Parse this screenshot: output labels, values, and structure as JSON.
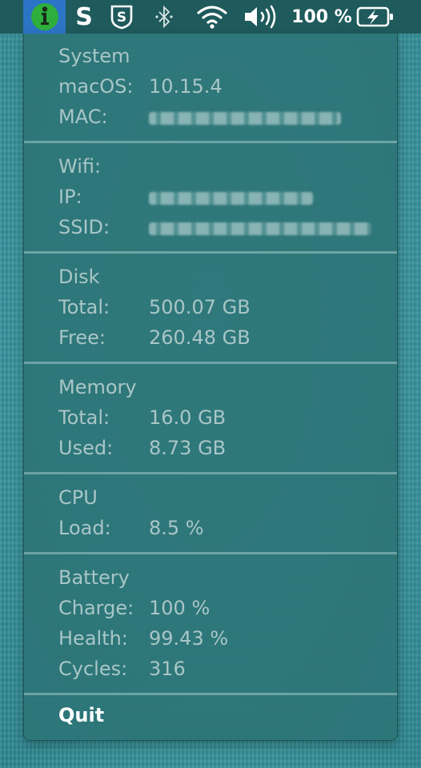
{
  "menubar": {
    "battery_percent": "100 %"
  },
  "sections": {
    "system": {
      "title": "System",
      "macos_label": "macOS:",
      "macos_value": "10.15.4",
      "mac_label": "MAC:"
    },
    "wifi": {
      "title": "Wifi:",
      "ip_label": "IP:",
      "ssid_label": "SSID:"
    },
    "disk": {
      "title": "Disk",
      "total_label": "Total:",
      "total_value": "500.07 GB",
      "free_label": "Free:",
      "free_value": "260.48 GB"
    },
    "memory": {
      "title": "Memory",
      "total_label": "Total:",
      "total_value": "16.0 GB",
      "used_label": "Used:",
      "used_value": "8.73 GB"
    },
    "cpu": {
      "title": "CPU",
      "load_label": "Load:",
      "load_value": "8.5 %"
    },
    "battery": {
      "title": "Battery",
      "charge_label": "Charge:",
      "charge_value": "100 %",
      "health_label": "Health:",
      "health_value": "99.43 %",
      "cycles_label": "Cycles:",
      "cycles_value": "316"
    }
  },
  "quit_label": "Quit",
  "colors": {
    "menubar": "#1f5a5c",
    "app_highlight": "#2c74c5",
    "panel": "#2d7476",
    "text": "#a9c6c7"
  }
}
